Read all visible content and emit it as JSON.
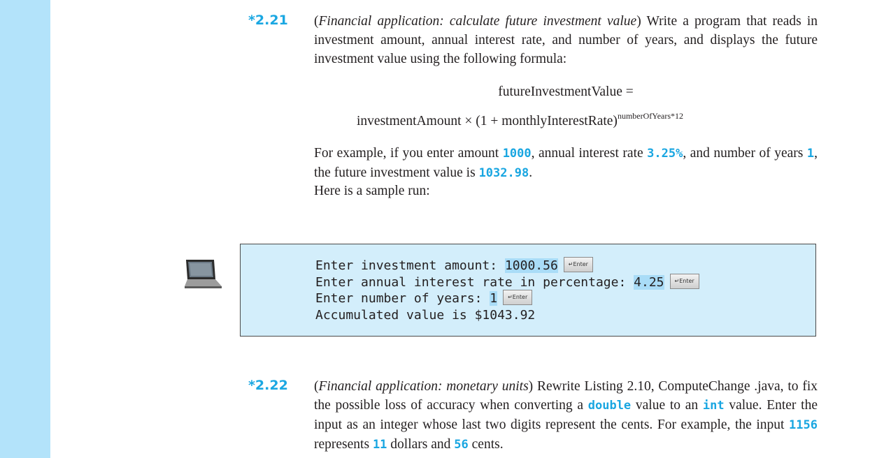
{
  "ex221": {
    "number": "*2.21",
    "title": "Financial application: calculate future investment value",
    "text1": " Write a program that reads in investment amount, annual interest rate, and number of years, and displays the future investment value using the following formula:",
    "formula_lhs": "futureInvestmentValue =",
    "formula_rhs": "investmentAmount × (1 + monthlyInterestRate)",
    "formula_exp": "numberOfYears*12",
    "example_a": "For example, if you enter amount ",
    "example_v1": "1000",
    "example_b": ", annual interest rate ",
    "example_v2": "3.25%",
    "example_c": ", and number of years ",
    "example_v3": "1",
    "example_d": ", the future investment value is ",
    "example_v4": "1032.98",
    "example_e": ".",
    "sample_run": "Here is a sample run:"
  },
  "console": {
    "line1_prompt": "Enter investment amount: ",
    "line1_input": "1000.56",
    "line2_prompt": "Enter annual interest rate in percentage: ",
    "line2_input": "4.25",
    "line3_prompt": "Enter number of years: ",
    "line3_input": "1",
    "line4": "Accumulated value is $1043.92",
    "enter_key_label": "↵Enter"
  },
  "ex222": {
    "number": "*2.22",
    "title": "Financial application: monetary units",
    "t1": " Rewrite Listing 2.10, ComputeChange .java, to fix the possible loss of accuracy when converting a ",
    "c1": "double",
    "t2": " value to an ",
    "c2": "int",
    "t3": " value. Enter the input as an integer whose last two digits represent the cents. For example, the input ",
    "c3": "1156",
    "t4": " represents ",
    "c4": "11",
    "t5": " dollars and ",
    "c5": "56",
    "t6": " cents."
  },
  "icons": {
    "laptop": "laptop-icon",
    "enter": "enter-key-icon"
  },
  "colors": {
    "sidebar": "#b3e3fa",
    "accent": "#1aa7e2",
    "console_bg": "#d3eefb",
    "input_highlight": "#a9dcf7"
  }
}
